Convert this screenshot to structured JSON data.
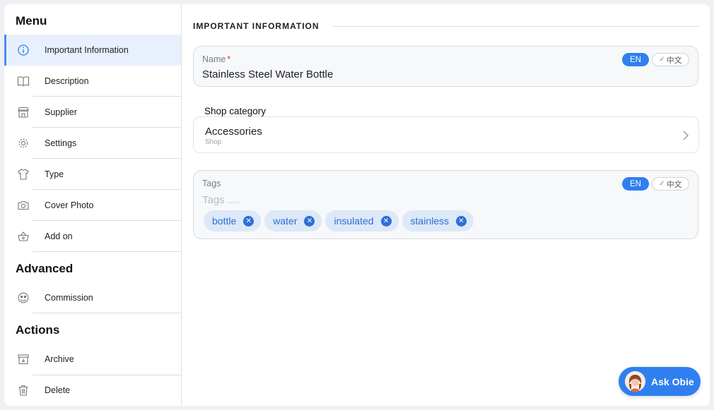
{
  "sidebar": {
    "menu_title": "Menu",
    "menu_items": [
      {
        "label": "Important Information",
        "icon": "info-icon",
        "active": true
      },
      {
        "label": "Description",
        "icon": "book-icon"
      },
      {
        "label": "Supplier",
        "icon": "store-icon"
      },
      {
        "label": "Settings",
        "icon": "gear-icon"
      },
      {
        "label": "Type",
        "icon": "shirt-icon"
      },
      {
        "label": "Cover Photo",
        "icon": "camera-icon"
      },
      {
        "label": "Add on",
        "icon": "basket-icon"
      }
    ],
    "advanced_title": "Advanced",
    "advanced_items": [
      {
        "label": "Commission",
        "icon": "commission-icon"
      }
    ],
    "actions_title": "Actions",
    "action_items": [
      {
        "label": "Archive",
        "icon": "archive-icon"
      },
      {
        "label": "Delete",
        "icon": "trash-icon"
      }
    ]
  },
  "main": {
    "heading": "IMPORTANT INFORMATION",
    "name_field": {
      "label": "Name",
      "required_mark": "*",
      "value": "Stainless Steel Water Bottle",
      "lang_en": "EN",
      "lang_zh": "中文"
    },
    "shop_category": {
      "title": "Shop category",
      "value": "Accessories",
      "sub": "Shop"
    },
    "tags_field": {
      "label": "Tags",
      "placeholder": "Tags ....",
      "lang_en": "EN",
      "lang_zh": "中文",
      "tags": [
        "bottle",
        "water",
        "insulated",
        "stainless"
      ]
    }
  },
  "assistant": {
    "label": "Ask Obie"
  },
  "colors": {
    "accent": "#2f7ff0",
    "active_bg": "#e8f0fd",
    "required": "#e23b3b"
  }
}
